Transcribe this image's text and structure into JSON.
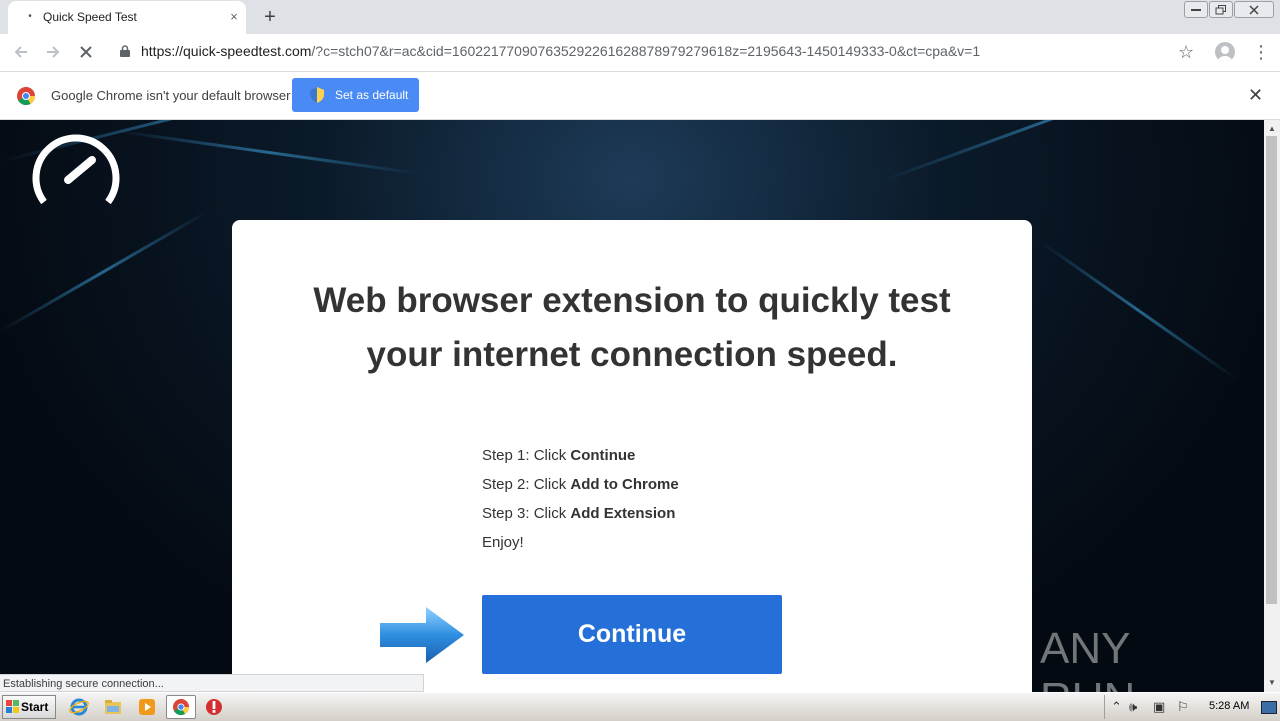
{
  "browser": {
    "tab": {
      "title": "Quick Speed Test",
      "favicon": "loading-spinner",
      "close_label": "×"
    },
    "new_tab_label": "+",
    "address_bar": {
      "host": "https://quick-speedtest.com",
      "rest": "/?c=stch07&r=ac&cid=160221770907635292261628878979279618z=2195643-1450149333-0&ct=cpa&v=1"
    },
    "infobar": {
      "message": "Google Chrome isn't your default browser",
      "button_label": "Set as default",
      "close_label": "✕"
    }
  },
  "page": {
    "headline_line1": "Web browser extension to quickly test",
    "headline_line2": "your internet connection speed.",
    "steps": [
      {
        "prefix": "Step 1: Click ",
        "action": "Continue"
      },
      {
        "prefix": "Step 2: Click ",
        "action": "Add to Chrome"
      },
      {
        "prefix": "Step 3: Click ",
        "action": "Add Extension"
      }
    ],
    "enjoy": "Enjoy!",
    "continue_label": "Continue",
    "watermark": "ANY RUN",
    "status": "Establishing secure connection..."
  },
  "taskbar": {
    "start_label": "Start",
    "clock": "5:28 AM",
    "pinned": [
      "internet-explorer-icon",
      "folder-icon",
      "media-player-icon",
      "chrome-icon",
      "antivirus-icon"
    ]
  },
  "colors": {
    "accent_blue": "#2470d8",
    "infobar_button": "#4a8af4",
    "page_background": "#05101c"
  }
}
